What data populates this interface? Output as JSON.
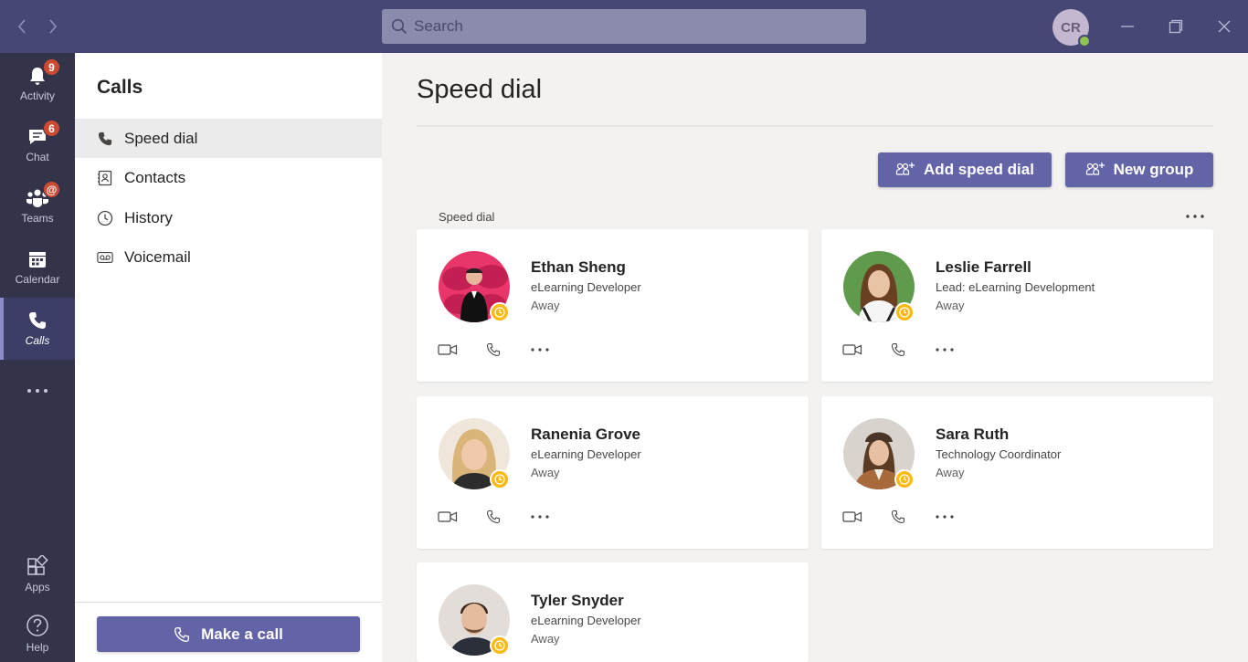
{
  "titlebar": {
    "search_placeholder": "Search",
    "user_initials": "CR"
  },
  "rail": {
    "items": [
      {
        "label": "Activity",
        "badge": "9"
      },
      {
        "label": "Chat",
        "badge": "6"
      },
      {
        "label": "Teams",
        "badge": "@"
      },
      {
        "label": "Calendar"
      },
      {
        "label": "Calls"
      },
      {
        "label": "Apps"
      },
      {
        "label": "Help"
      }
    ]
  },
  "panel": {
    "title": "Calls",
    "items": [
      {
        "label": "Speed dial"
      },
      {
        "label": "Contacts"
      },
      {
        "label": "History"
      },
      {
        "label": "Voicemail"
      }
    ],
    "make_call_label": "Make a call"
  },
  "main": {
    "title": "Speed dial",
    "add_speed_dial_label": "Add speed dial",
    "new_group_label": "New group",
    "section_label": "Speed dial",
    "contacts": [
      {
        "name": "Ethan Sheng",
        "role": "eLearning Developer",
        "presence": "Away"
      },
      {
        "name": "Leslie Farrell",
        "role": "Lead: eLearning Development",
        "presence": "Away"
      },
      {
        "name": "Ranenia Grove",
        "role": "eLearning Developer",
        "presence": "Away"
      },
      {
        "name": "Sara Ruth",
        "role": "Technology Coordinator",
        "presence": "Away"
      },
      {
        "name": "Tyler Snyder",
        "role": "eLearning Developer",
        "presence": "Away"
      }
    ]
  },
  "colors": {
    "titlebar": "#464775",
    "rail": "#33344a",
    "accent": "#6264a7",
    "away": "#fdb913",
    "badge": "#cc4a31"
  }
}
